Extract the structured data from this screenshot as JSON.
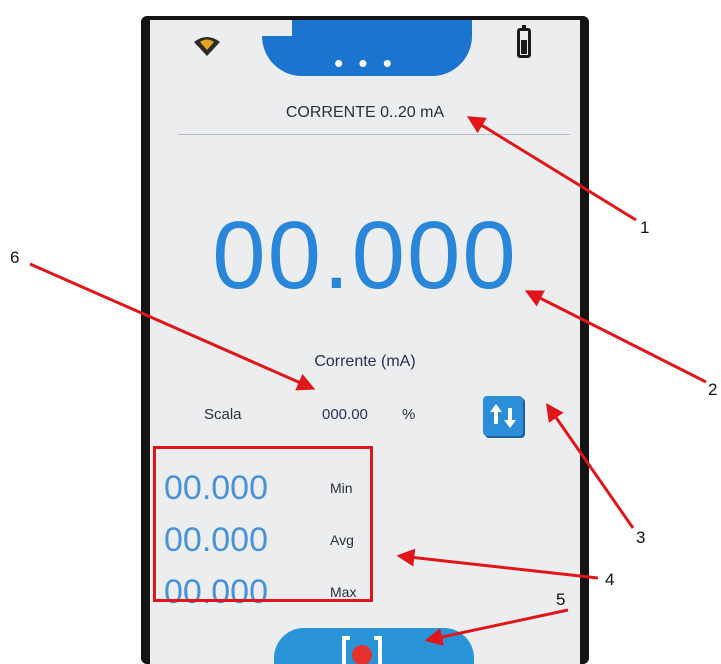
{
  "header": {
    "title": "CORRENTE 0..20 mA",
    "dots": "• • •"
  },
  "reading": {
    "main_value": "00.000",
    "unit_label": "Corrente (mA)"
  },
  "scale": {
    "label": "Scala",
    "value": "000.00",
    "unit": "%"
  },
  "stats": [
    {
      "value": "00.000",
      "label": "Min"
    },
    {
      "value": "00.000",
      "label": "Avg"
    },
    {
      "value": "00.000",
      "label": "Max"
    }
  ],
  "icons": {
    "logo": "logo-icon",
    "battery": "battery-icon",
    "swap": "swap-arrows-icon",
    "record": "record-icon"
  },
  "colors": {
    "accent": "#1b75d0",
    "value_blue": "#2a86d8",
    "annotation_red": "#e0161b",
    "record_red": "#e5322d"
  },
  "annotations": {
    "labels": [
      "1",
      "2",
      "3",
      "4",
      "5",
      "6"
    ]
  }
}
